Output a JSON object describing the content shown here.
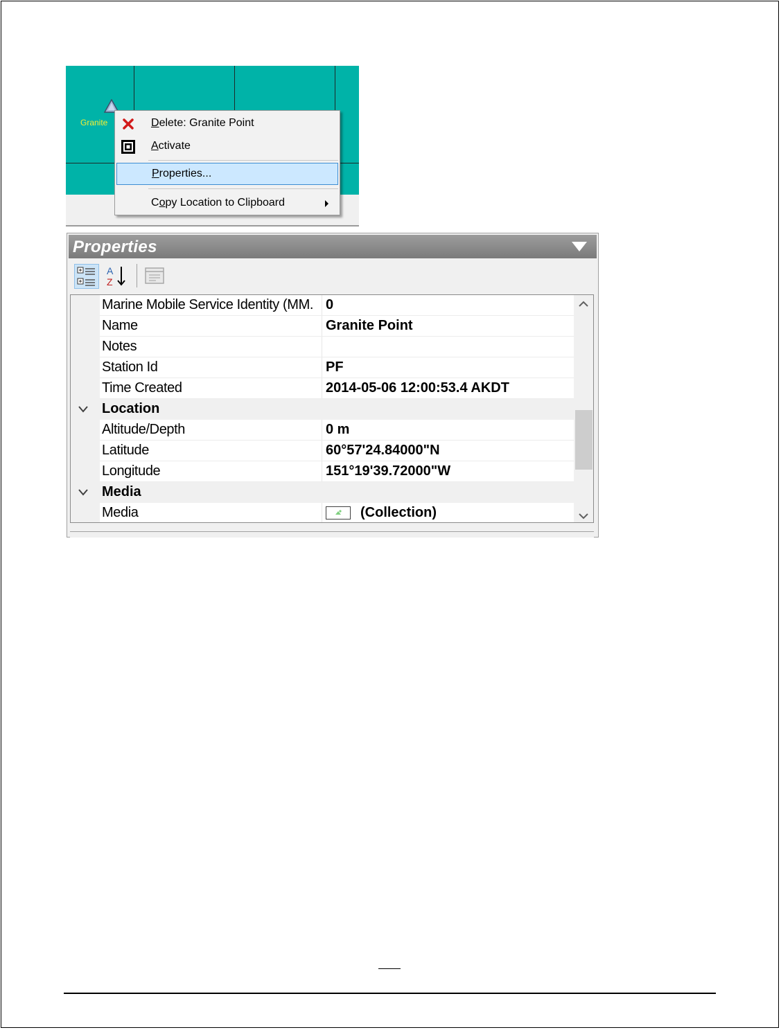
{
  "map": {
    "marker_label": "Granite",
    "colors": {
      "background": "#00b3a8",
      "label": "#f5ee33"
    }
  },
  "context_menu": {
    "items": [
      {
        "label_underlined": "D",
        "label_rest": "elete: Granite Point",
        "icon": "close-x-icon"
      },
      {
        "label_underlined": "A",
        "label_rest": "ctivate",
        "icon": "activate-icon"
      },
      {
        "label_underlined": "P",
        "label_rest": "roperties...",
        "icon": ""
      },
      {
        "label_pre": "C",
        "label_underlined": "o",
        "label_rest": "py Location to Clipboard",
        "icon": "chevron-right-icon"
      }
    ],
    "highlighted_index": 2
  },
  "properties_panel": {
    "title": "Properties",
    "toolbar": {
      "categorized_icon": "categorized-view-icon",
      "alphabetical_icon": "sort-az-icon",
      "property_pages_icon": "property-pages-icon"
    },
    "rows": [
      {
        "name": "Marine Mobile Service Identity (MM.",
        "value": "0"
      },
      {
        "name": "Name",
        "value": "Granite Point"
      },
      {
        "name": "Notes",
        "value": ""
      },
      {
        "name": "Station Id",
        "value": "PF"
      },
      {
        "name": "Time Created",
        "value": "2014-05-06 12:00:53.4 AKDT"
      }
    ],
    "location_category": "Location",
    "location_rows": [
      {
        "name": "Altitude/Depth",
        "value": "0 m"
      },
      {
        "name": "Latitude",
        "value": "60°57'24.84000\"N"
      },
      {
        "name": "Longitude",
        "value": "151°19'39.72000\"W"
      }
    ],
    "media_category": "Media",
    "media_row": {
      "name": "Media",
      "value": "(Collection)"
    }
  }
}
